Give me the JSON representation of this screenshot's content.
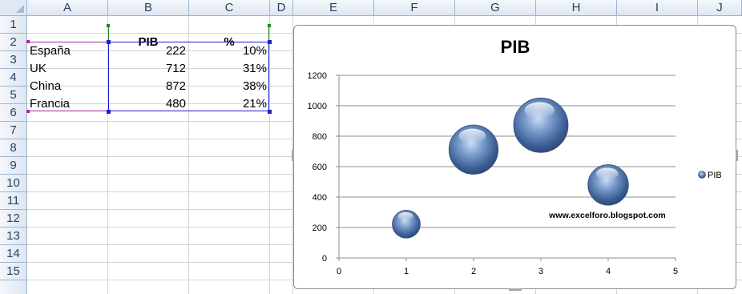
{
  "columns": [
    "A",
    "B",
    "C",
    "D",
    "E",
    "F",
    "G",
    "H",
    "I",
    "J"
  ],
  "rows": [
    "1",
    "2",
    "3",
    "4",
    "5",
    "6",
    "7",
    "8",
    "9",
    "10",
    "11",
    "12",
    "13",
    "14",
    "15"
  ],
  "cells": {
    "B1": "PIB",
    "C1": "%",
    "A2": "España",
    "B2": "222",
    "C2": "10%",
    "A3": "UK",
    "B3": "712",
    "C3": "31%",
    "A4": "China",
    "B4": "872",
    "C4": "38%",
    "A5": "Francia",
    "B5": "480",
    "C5": "21%"
  },
  "chart_data": {
    "type": "bubble",
    "title": "PIB",
    "xlim": [
      0,
      5
    ],
    "ylim": [
      0,
      1200
    ],
    "x_ticks": [
      "0",
      "1",
      "2",
      "3",
      "4",
      "5"
    ],
    "y_ticks": [
      "0",
      "200",
      "400",
      "600",
      "800",
      "1000",
      "1200"
    ],
    "grid": true,
    "legend_position": "right",
    "series": [
      {
        "name": "PIB",
        "color": "#4f74aa",
        "points": [
          {
            "x": 1,
            "y": 222,
            "size": 10
          },
          {
            "x": 2,
            "y": 712,
            "size": 31
          },
          {
            "x": 3,
            "y": 872,
            "size": 38
          },
          {
            "x": 4,
            "y": 480,
            "size": 21
          }
        ]
      }
    ],
    "annotation": "www.excelforo.blogspot.com"
  }
}
